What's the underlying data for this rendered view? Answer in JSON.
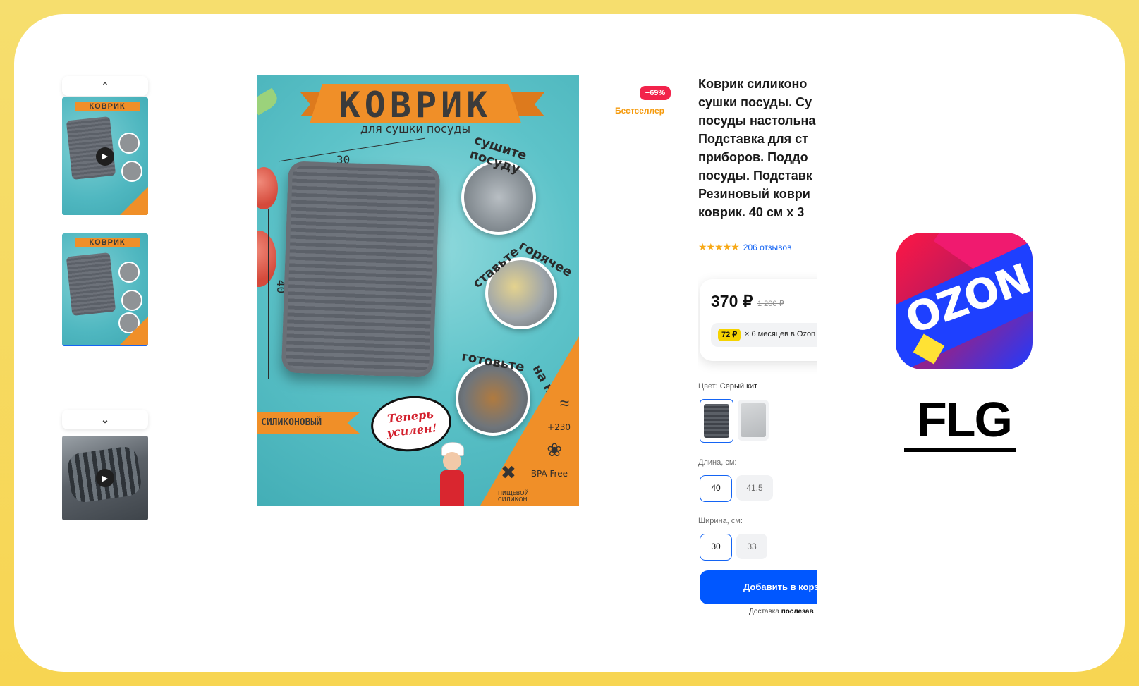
{
  "product": {
    "title_lines": [
      "Коврик силиконо",
      "сушки посуды. Су",
      "посуды настольна",
      "Подставка для ст",
      "приборов. Поддо",
      "посуды. Подставк",
      "Резиновый коври",
      "коврик. 40 см х 3"
    ],
    "rating_stars": "★★★★★",
    "reviews": "206 отзывов",
    "discount_badge": "−69%",
    "bestseller_badge": "Бестселлер",
    "price": "370 ₽",
    "old_price": "1 200 ₽",
    "installment_amount": "72 ₽",
    "installment_text": "× 6 месяцев в Ozon",
    "color_label": "Цвет:",
    "color_value": "Серый кит",
    "length_label": "Длина, см:",
    "length_options": [
      "40",
      "41.5"
    ],
    "width_label": "Ширина, см:",
    "width_options": [
      "30",
      "33"
    ],
    "cart_button": "Добавить в корз",
    "delivery_prefix": "Доставка",
    "delivery_value": "послезав"
  },
  "gallery": {
    "up_icon": "chevron-up-icon",
    "down_icon": "chevron-down-icon",
    "play_icon": "play-icon"
  },
  "poster": {
    "title": "КОВРИК",
    "subtitle": "для сушки посуды",
    "width_mark": "30",
    "length_mark": "40",
    "label_dry": "сушите посуду",
    "label_hot_1": "ставьте",
    "label_hot_2": "горячее",
    "label_cook_1": "готовьте",
    "label_cook_2": "на нём",
    "silicone_tag": "СИЛИКОНОВЫЙ",
    "speech": "Теперь усилен!",
    "temp": "+230",
    "bpa": "BPA Free",
    "food_silicone": "ПИЩЕВОЙ СИЛИКОН"
  },
  "branding": {
    "ozon_logo_text": "OZON",
    "watermark": "FLG"
  },
  "colors": {
    "background_yellow": "#f6d960",
    "ozon_blue": "#0057ff",
    "discount_red": "#f2234b",
    "bestseller_orange": "#f59a0c",
    "poster_orange": "#f08f28"
  }
}
